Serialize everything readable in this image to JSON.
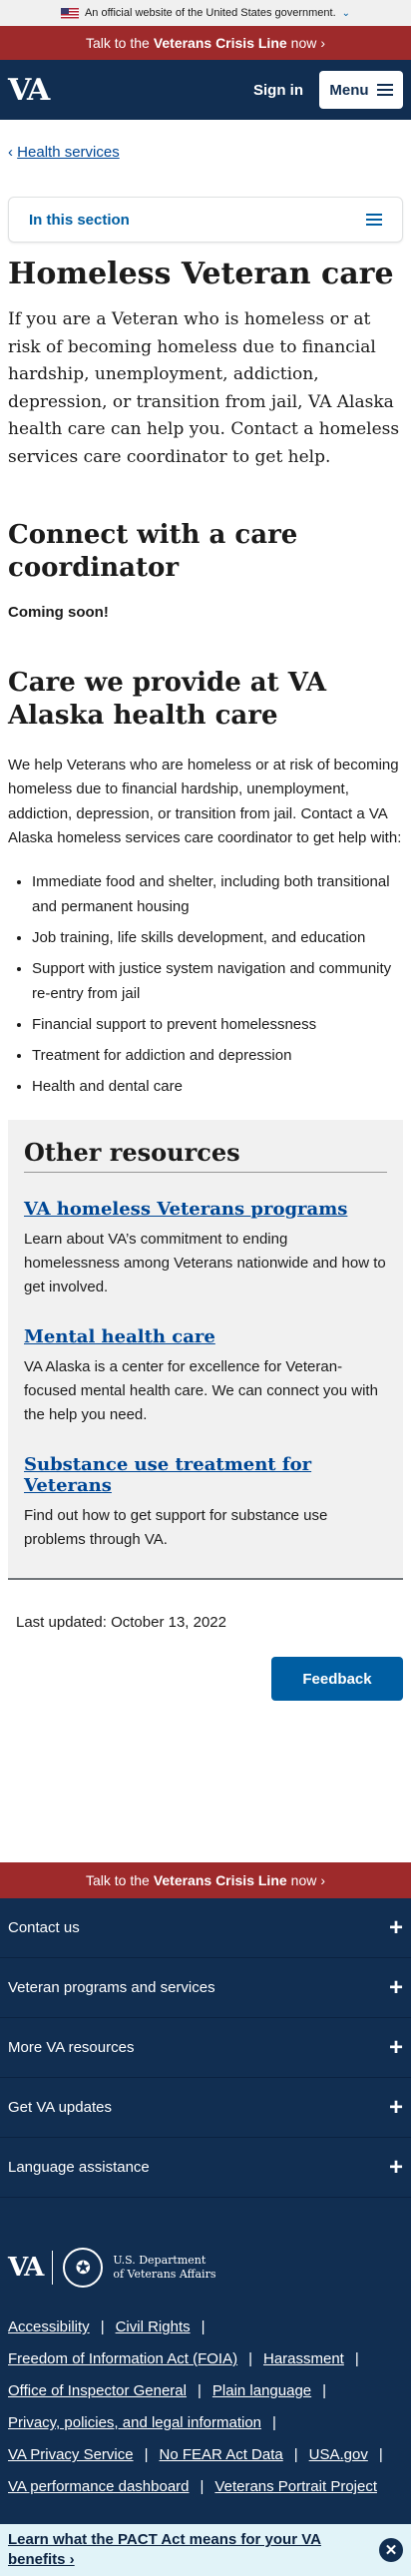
{
  "banner": {
    "text": "An official website of the United States government."
  },
  "crisis": {
    "prefix": "Talk to the",
    "strong": "Veterans Crisis Line",
    "suffix": "now",
    "arrow": "›"
  },
  "header": {
    "logo": "VA",
    "sign_in": "Sign in",
    "menu": "Menu"
  },
  "breadcrumb": {
    "chev": "‹",
    "label": "Health services"
  },
  "section_nav": {
    "label": "In this section"
  },
  "page": {
    "title": "Homeless Veteran care",
    "intro": "If you are a Veteran who is homeless or at risk of becoming homeless due to financial hardship, unemployment, addiction, depression, or transition from jail, VA Alaska health care can help you. Contact a homeless services care coordinator to get help.",
    "connect_heading": "Connect with a care coordinator",
    "coming_soon": "Coming soon!",
    "care_heading": "Care we provide at VA Alaska health care",
    "care_paragraph": "We help Veterans who are homeless or at risk of becoming homeless due to financial hardship, unemployment, addiction, depression, or transition from jail. Contact a VA Alaska homeless services care coordinator to get help with:",
    "care_items": [
      "Immediate food and shelter, including both transitional and permanent housing",
      "Job training, life skills development, and education",
      "Support with justice system navigation and community re-entry from jail",
      "Financial support to prevent homelessness",
      "Treatment for addiction and depression",
      "Health and dental care"
    ]
  },
  "other_resources": {
    "heading": "Other resources",
    "items": [
      {
        "title": "VA homeless Veterans programs",
        "desc": "Learn about VA’s commitment to ending homelessness among Veterans nationwide and how to get involved."
      },
      {
        "title": "Mental health care",
        "desc": "VA Alaska is a center for excellence for Veteran-focused mental health care. We can connect you with the help you need."
      },
      {
        "title": "Substance use treatment for Veterans",
        "desc": "Find out how to get support for substance use problems through VA."
      }
    ]
  },
  "last_updated": "Last updated: October 13, 2022",
  "feedback": "Feedback",
  "footer": {
    "accordion": [
      "Contact us",
      "Veteran programs and services",
      "More VA resources",
      "Get VA updates",
      "Language assistance"
    ],
    "plus": "+",
    "logo": "VA",
    "dept_line1": "U.S. Department",
    "dept_line2": "of Veterans Affairs",
    "links": [
      [
        "Accessibility",
        "Civil Rights"
      ],
      [
        "Freedom of Information Act (FOIA)",
        "Harassment"
      ],
      [
        "Office of Inspector General",
        "Plain language"
      ],
      [
        "Privacy, policies, and legal information"
      ],
      [
        "VA Privacy Service",
        "No FEAR Act Data",
        "USA.gov"
      ],
      [
        "VA performance dashboard",
        "Veterans Portrait Project"
      ]
    ],
    "pact": "Learn what the PACT Act means for your VA benefits ›",
    "close": "✕"
  }
}
